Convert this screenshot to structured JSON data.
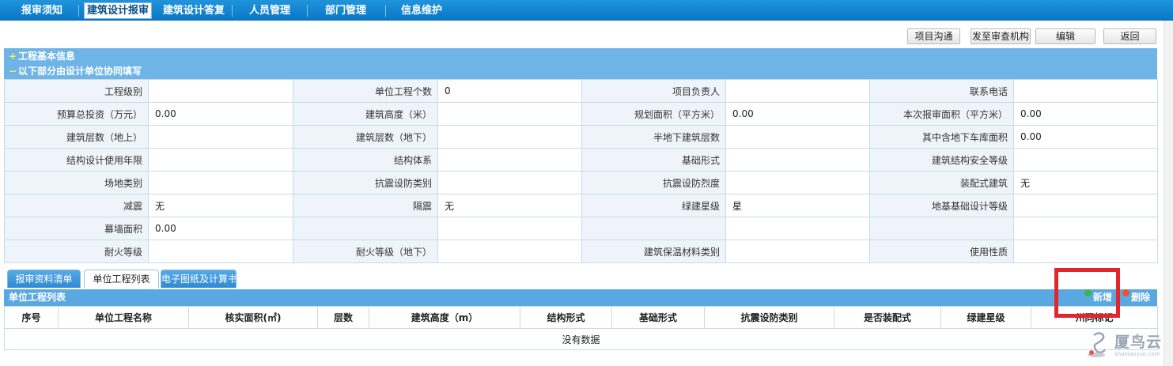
{
  "nav": {
    "items": [
      "报审须知",
      "建筑设计报审",
      "建筑设计答复",
      "人员管理",
      "部门管理",
      "信息维护"
    ],
    "active_index": 1
  },
  "toolbar": {
    "project_comm": "项目沟通",
    "send_review": "发至审查机构",
    "edit": "编辑",
    "back": "返回"
  },
  "sections": {
    "basic_info": "工程基本信息",
    "basic_info_symbol": "+",
    "design_fill": "以下部分由设计单位协同填写",
    "design_fill_symbol": "−"
  },
  "info_rows": [
    [
      {
        "label": "工程级别",
        "value": ""
      },
      {
        "label": "单位工程个数",
        "value": "0"
      },
      {
        "label": "项目负责人",
        "value": ""
      },
      {
        "label": "联系电话",
        "value": ""
      }
    ],
    [
      {
        "label": "预算总投资（万元）",
        "value": "0.00"
      },
      {
        "label": "建筑高度（米）",
        "value": ""
      },
      {
        "label": "规划面积（平方米）",
        "value": "0.00"
      },
      {
        "label": "本次报审面积（平方米）",
        "value": "0.00"
      }
    ],
    [
      {
        "label": "建筑层数（地上）",
        "value": ""
      },
      {
        "label": "建筑层数（地下）",
        "value": ""
      },
      {
        "label": "半地下建筑层数",
        "value": ""
      },
      {
        "label": "其中含地下车库面积",
        "value": "0.00"
      }
    ],
    [
      {
        "label": "结构设计使用年限",
        "value": ""
      },
      {
        "label": "结构体系",
        "value": ""
      },
      {
        "label": "基础形式",
        "value": ""
      },
      {
        "label": "建筑结构安全等级",
        "value": ""
      }
    ],
    [
      {
        "label": "场地类别",
        "value": ""
      },
      {
        "label": "抗震设防类别",
        "value": ""
      },
      {
        "label": "抗震设防烈度",
        "value": ""
      },
      {
        "label": "装配式建筑",
        "value": "无"
      }
    ],
    [
      {
        "label": "减震",
        "value": "无"
      },
      {
        "label": "隔震",
        "value": "无"
      },
      {
        "label": "绿建星级",
        "value": "星"
      },
      {
        "label": "地基基础设计等级",
        "value": ""
      }
    ],
    [
      {
        "label": "幕墙面积",
        "value": "0.00"
      },
      {
        "label": "",
        "value": ""
      },
      {
        "label": "",
        "value": ""
      },
      {
        "label": "",
        "value": ""
      }
    ],
    [
      {
        "label": "耐火等级",
        "value": ""
      },
      {
        "label": "耐火等级（地下）",
        "value": ""
      },
      {
        "label": "建筑保温材料类别",
        "value": ""
      },
      {
        "label": "使用性质",
        "value": ""
      }
    ]
  ],
  "tabs": [
    "报审资料清单",
    "单位工程列表",
    "电子图纸及计算书"
  ],
  "active_tab": 1,
  "unit_list": {
    "title": "单位工程列表",
    "add": "新增",
    "delete": "删除",
    "columns": [
      "序号",
      "单位工程名称",
      "核实面积(㎡)",
      "层数",
      "建筑高度（m）",
      "结构形式",
      "基础形式",
      "抗震设防类别",
      "是否装配式",
      "绿建星级",
      "州同标记"
    ],
    "empty": "没有数据"
  },
  "watermark": {
    "name": "厦鸟云",
    "url": "shaniaoyun.com"
  },
  "colors": {
    "nav_bg": "#0a78c6",
    "section_bg": "#6fb4e6",
    "label_bg": "#eef4fa",
    "highlight": "#e0262f"
  }
}
